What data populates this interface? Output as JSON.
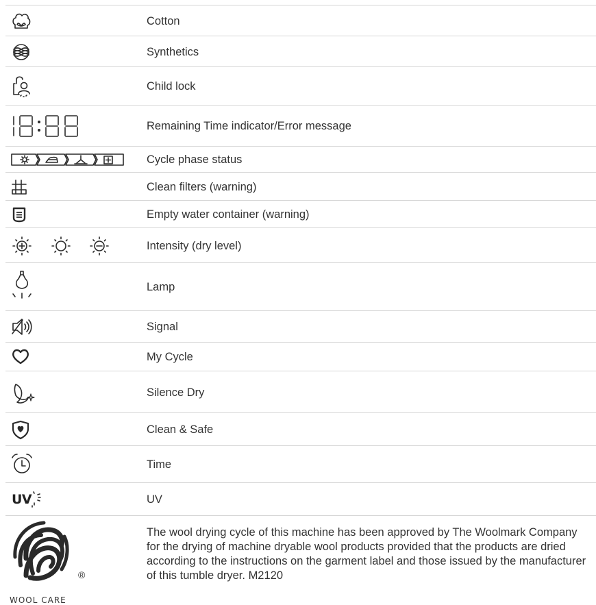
{
  "rows": [
    {
      "icon": "cotton-icon",
      "label": "Cotton"
    },
    {
      "icon": "synthetics-icon",
      "label": "Synthetics"
    },
    {
      "icon": "child-lock-icon",
      "label": "Child lock"
    },
    {
      "icon": "seven-segment-display-icon",
      "display": "18:88",
      "label": "Remaining Time indicator/Error message"
    },
    {
      "icon": "cycle-phase-icons",
      "label": "Cycle phase status"
    },
    {
      "icon": "filter-grid-icon",
      "label": "Clean filters (warning)"
    },
    {
      "icon": "water-container-icon",
      "label": "Empty water container (warning)"
    },
    {
      "icon": "intensity-icons",
      "label": "Intensity (dry level)"
    },
    {
      "icon": "lamp-icon",
      "label": "Lamp"
    },
    {
      "icon": "speaker-signal-icon",
      "label": "Signal"
    },
    {
      "icon": "heart-icon",
      "label": "My Cycle"
    },
    {
      "icon": "moon-star-icon",
      "label": "Silence Dry"
    },
    {
      "icon": "shield-heart-icon",
      "label": "Clean & Safe"
    },
    {
      "icon": "alarm-clock-icon",
      "label": "Time"
    },
    {
      "icon": "uv-icon",
      "icon_text": "UV",
      "label": "UV"
    }
  ],
  "woolmark": {
    "logo_text": "WOOL CARE",
    "registered": "®",
    "description": "The wool drying cycle of this machine has been approved by The Woolmark Company for the drying of machine dryable wool products provided that the products are dried according to the instructions on the garment label and those issued by the manufacturer of this tumble dryer. M2120"
  }
}
